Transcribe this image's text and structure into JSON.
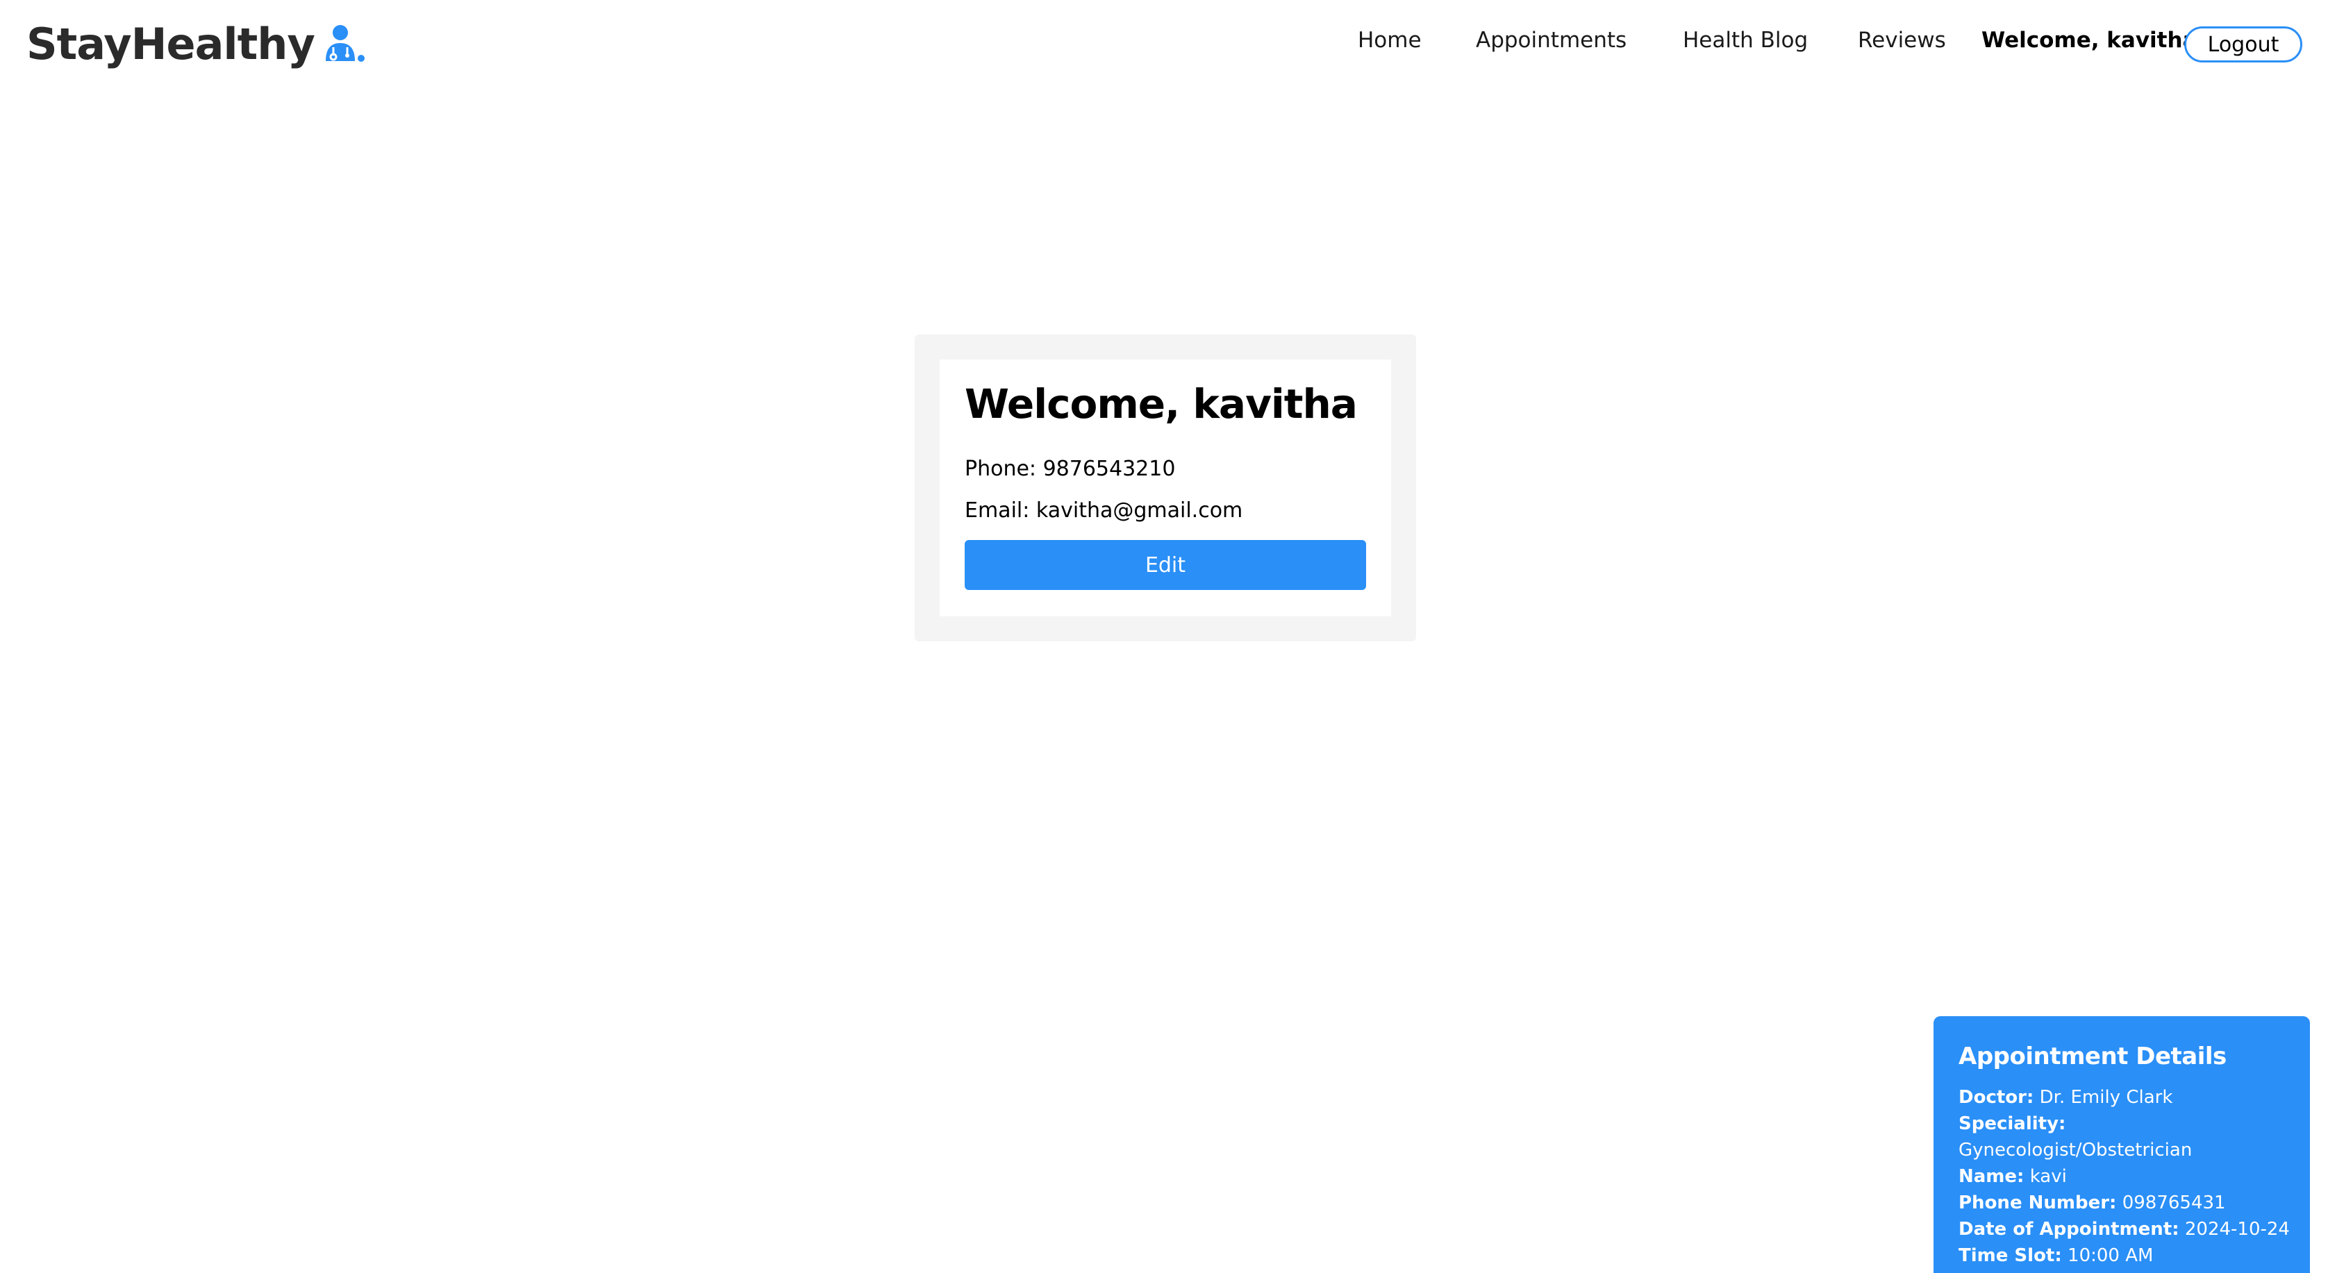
{
  "brand": {
    "name": "StayHealthy",
    "icon": "doctor-icon",
    "accent": "#2a8ff7"
  },
  "nav": {
    "links": [
      "Home",
      "Appointments",
      "Health Blog",
      "Reviews"
    ],
    "welcome": "Welcome, kavitha",
    "logout_label": "Logout"
  },
  "profile": {
    "heading": "Welcome, kavitha",
    "phone": "Phone: 9876543210",
    "email": "Email: kavitha@gmail.com",
    "edit_label": "Edit"
  },
  "appointment": {
    "title": "Appointment Details",
    "doctor_label": "Doctor:",
    "doctor": "Dr. Emily Clark",
    "speciality_label": "Speciality:",
    "speciality": "Gynecologist/Obstetrician",
    "name_label": "Name:",
    "name": "kavi",
    "phone_label": "Phone Number:",
    "phone": "098765431",
    "date_label": "Date of Appointment:",
    "date": "2024-10-24",
    "slot_label": "Time Slot:",
    "slot": "10:00 AM"
  },
  "colors": {
    "primary": "#2a8ff7",
    "card_bg": "#f4f4f4"
  }
}
